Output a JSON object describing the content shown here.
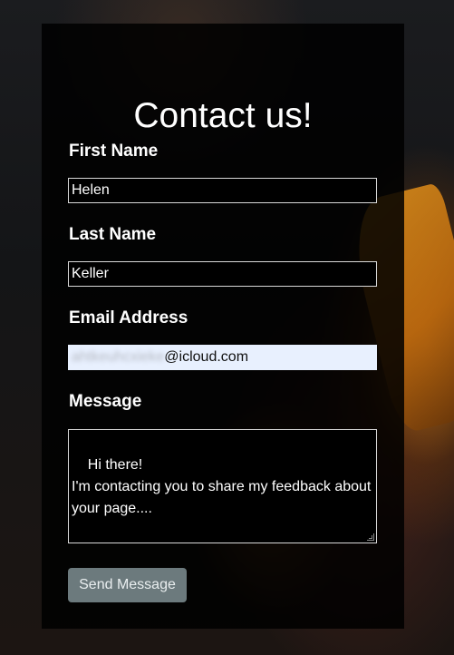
{
  "form": {
    "title": "Contact us!",
    "first_name": {
      "label": "First Name",
      "value": "Helen"
    },
    "last_name": {
      "label": "Last Name",
      "value": "Keller"
    },
    "email": {
      "label": "Email Address",
      "value_hidden_part": "ahtkeuhcxieke",
      "value_visible_part": "@icloud.com"
    },
    "message": {
      "label": "Message",
      "value": "Hi there!\nI'm contacting you to share my feedback about your page...."
    },
    "submit_label": "Send Message"
  },
  "colors": {
    "card_bg": "#000000",
    "button_bg": "#6c7a7d",
    "autofill_bg": "#e8f0fe"
  }
}
